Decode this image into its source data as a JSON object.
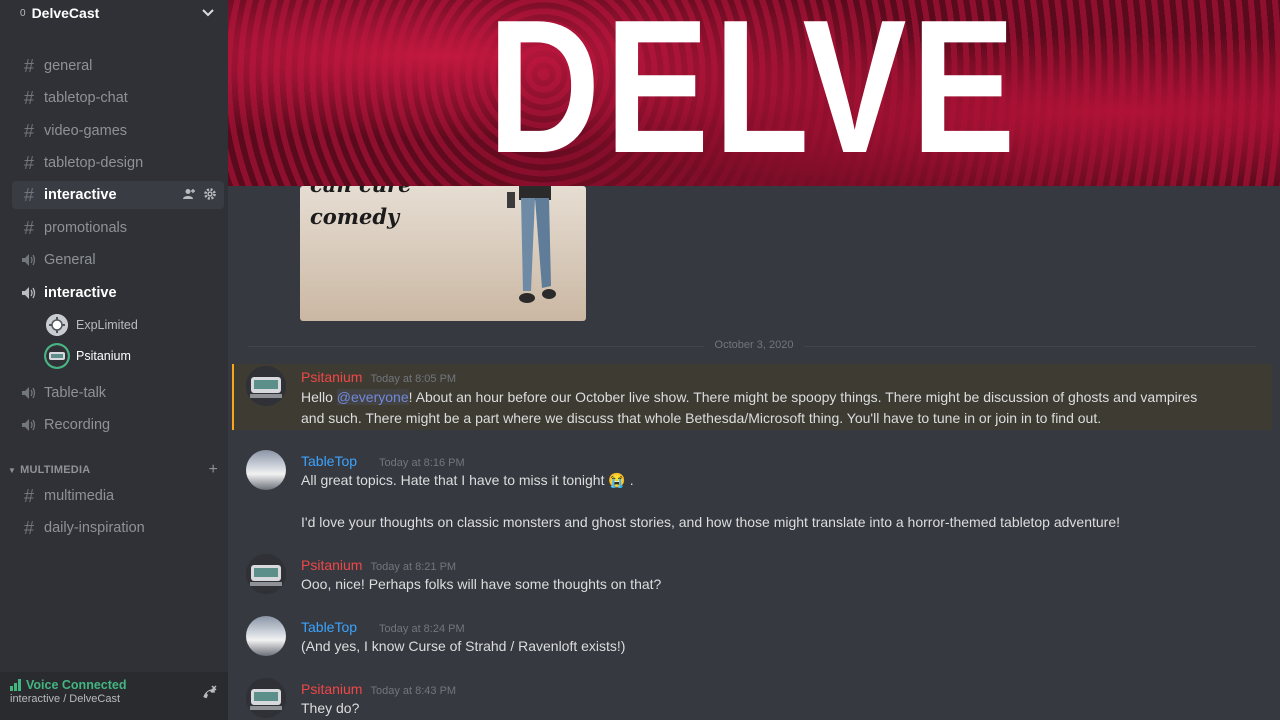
{
  "server": {
    "badge": "0",
    "name": "DelveCast"
  },
  "channels": {
    "general": "general",
    "tabletop_chat": "tabletop-chat",
    "video_games": "video-games",
    "tabletop_design": "tabletop-design",
    "interactive_text": "interactive",
    "promotionals": "promotionals",
    "voice_general": "General",
    "voice_interactive": "interactive",
    "voice_users": [
      "ExpLimited",
      "Psitanium"
    ],
    "voice_table_talk": "Table-talk",
    "voice_recording": "Recording"
  },
  "category": {
    "name": "MULTIMEDIA",
    "channels": [
      "multimedia",
      "daily-inspiration"
    ]
  },
  "voice_panel": {
    "status": "Voice Connected",
    "location": "interactive / DelveCast"
  },
  "banner": {
    "title": "DELVE"
  },
  "embed": {
    "caption_line1": "can cure",
    "caption_line2": "comedy"
  },
  "date_divider": "October 3, 2020",
  "messages": [
    {
      "author": "Psitanium",
      "time": "Today at 8:05 PM",
      "lines": [
        "Hello ",
        "@everyone",
        "! About an hour before our October live show. There might be spoopy things. There might be discussion of ghosts and vampires",
        "and such. There might be a part where we discuss that whole Bethesda/Microsoft thing. You'll have to tune in or join in to find out."
      ]
    },
    {
      "author": "TableTop ",
      "time": "Today at 8:16 PM",
      "lines": [
        "All great topics. Hate that I have to miss it tonight 😭 .",
        "I'd love your thoughts on classic monsters and ghost stories, and how those might translate into a horror-themed tabletop adventure!"
      ]
    },
    {
      "author": "Psitanium",
      "time": "Today at 8:21 PM",
      "lines": [
        "Ooo, nice! Perhaps folks will have some thoughts on that?"
      ]
    },
    {
      "author": "TableTop ",
      "time": "Today at 8:24 PM",
      "lines": [
        "(And yes, I know Curse of Strahd / Ravenloft exists!)"
      ]
    },
    {
      "author": "Psitanium",
      "time": "Today at 8:43 PM",
      "lines": [
        "They do?"
      ]
    }
  ],
  "colors": {
    "psitanium": "#f04747",
    "tabletop": "#3ca4ff",
    "voice_green": "#43b581",
    "mention_bar": "#faa61a"
  }
}
